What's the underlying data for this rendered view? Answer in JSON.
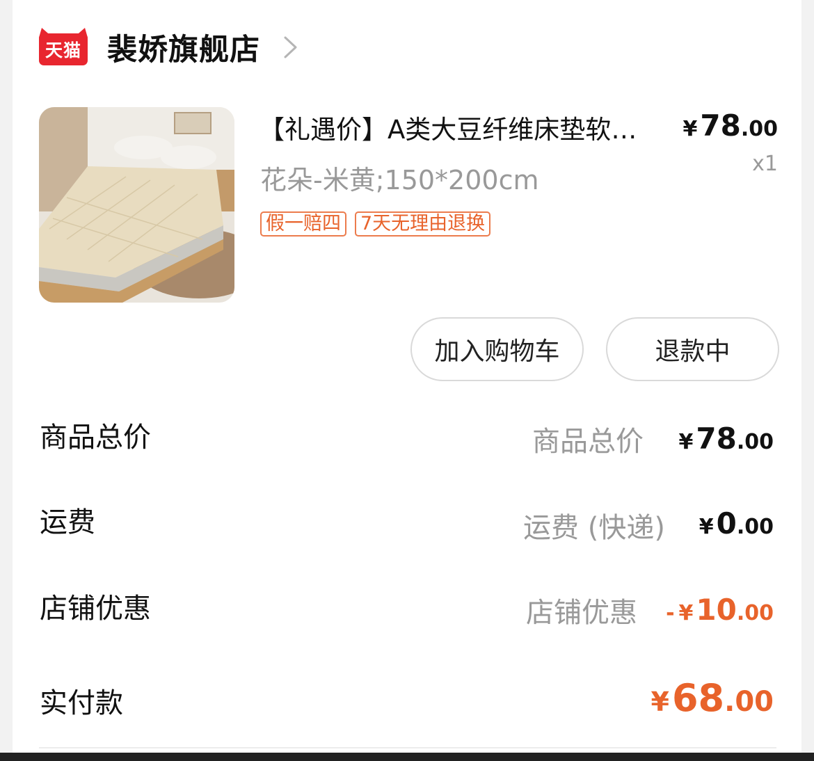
{
  "store": {
    "platform_badge": "天猫",
    "name": "裴娇旗舰店"
  },
  "product": {
    "title": "【礼遇价】A类大豆纤维床垫软垫家用",
    "price": {
      "yen": "¥",
      "int": "78",
      "dec": ".00"
    },
    "sku": "花朵-米黄;150*200cm",
    "qty": "x1",
    "tags": [
      "假一赔四",
      "7天无理由退换"
    ]
  },
  "actions": {
    "add_to_cart": "加入购物车",
    "refund_status": "退款中"
  },
  "summary": {
    "goods_total": {
      "label": "商品总价",
      "sub": "商品总价",
      "yen": "¥",
      "int": "78",
      "dec": ".00"
    },
    "shipping": {
      "label": "运费",
      "sub": "运费 (快递)",
      "yen": "¥",
      "int": "0",
      "dec": ".00"
    },
    "store_discount": {
      "label": "店铺优惠",
      "sub": "店铺优惠",
      "sign": "-",
      "yen": "¥",
      "int": "10",
      "dec": ".00"
    },
    "paid": {
      "label": "实付款",
      "yen": "¥",
      "int": "68",
      "dec": ".00"
    }
  },
  "colors": {
    "accent": "#e8632b",
    "tmall_red": "#e8262f",
    "muted_text": "#999999"
  }
}
